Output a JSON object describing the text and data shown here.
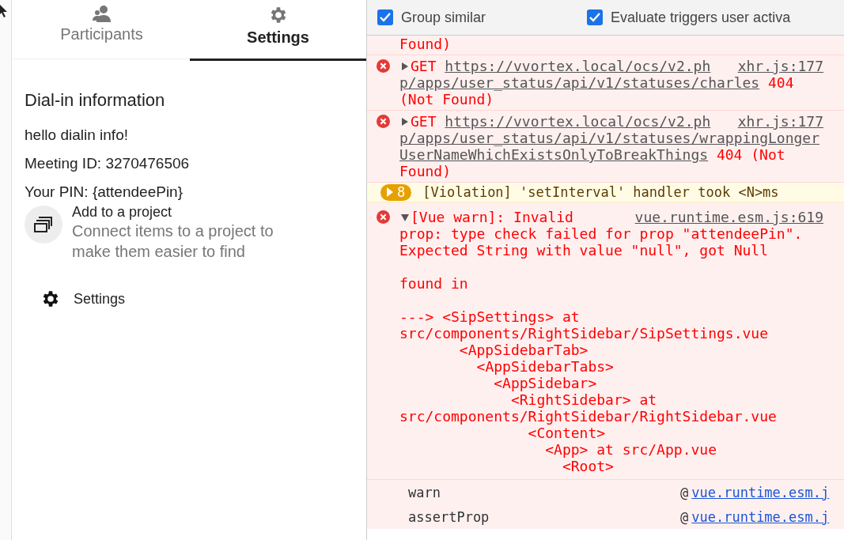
{
  "sidebar": {
    "tabs": [
      {
        "label": "Participants",
        "selected": false
      },
      {
        "label": "Settings",
        "selected": true
      }
    ],
    "dialin": {
      "heading": "Dial-in information",
      "lines": [
        "hello dialin info!",
        "Meeting ID: 3270476506",
        "Your PIN: {attendeePin}"
      ]
    },
    "project": {
      "title": "Add to a project",
      "subtitle": "Connect items to a project to make them easier to find"
    },
    "settings_link": "Settings"
  },
  "console": {
    "options": [
      {
        "label": "Group similar",
        "checked": true
      },
      {
        "label": "Evaluate triggers user activa",
        "checked": true
      }
    ],
    "messages": [
      {
        "kind": "tail",
        "text": "Found)"
      },
      {
        "kind": "request",
        "expanded": false,
        "method": "GET",
        "url_lines": [
          "https://vvortex.local/ocs/v2.ph",
          "p/apps/user_status/api/v1/statuses/charles"
        ],
        "source": "xhr.js:177",
        "status_lines": [
          "404",
          "(Not Found)"
        ]
      },
      {
        "kind": "request",
        "expanded": false,
        "method": "GET",
        "url_lines": [
          "https://vvortex.local/ocs/v2.ph",
          "p/apps/user_status/api/v1/statuses/wrappingLonger",
          "UserNameWhichExistsOnlyToBreakThings"
        ],
        "source": "xhr.js:177",
        "status_lines": [
          "404 (Not",
          "Found)"
        ]
      },
      {
        "kind": "violation",
        "count": "8",
        "text": "[Violation] 'setInterval' handler took <N>ms"
      },
      {
        "kind": "warning",
        "expanded": true,
        "source": "vue.runtime.esm.js:619",
        "first_line": "[Vue warn]: Invalid",
        "text": "prop: type check failed for prop \"attendeePin\". Expected String with value \"null\", got Null\n\nfound in\n\n---> <SipSettings> at src/components/RightSidebar/SipSettings.vue\n       <AppSidebarTab>\n         <AppSidebarTabs>\n           <AppSidebar>\n             <RightSidebar> at src/components/RightSidebar/RightSidebar.vue\n               <Content>\n                 <App> at src/App.vue\n                   <Root>"
      }
    ],
    "stack": [
      {
        "function": "warn",
        "at": "@",
        "link": "vue.runtime.esm.j"
      },
      {
        "function": "assertProp",
        "at": "@",
        "link": "vue.runtime.esm.j"
      }
    ]
  }
}
